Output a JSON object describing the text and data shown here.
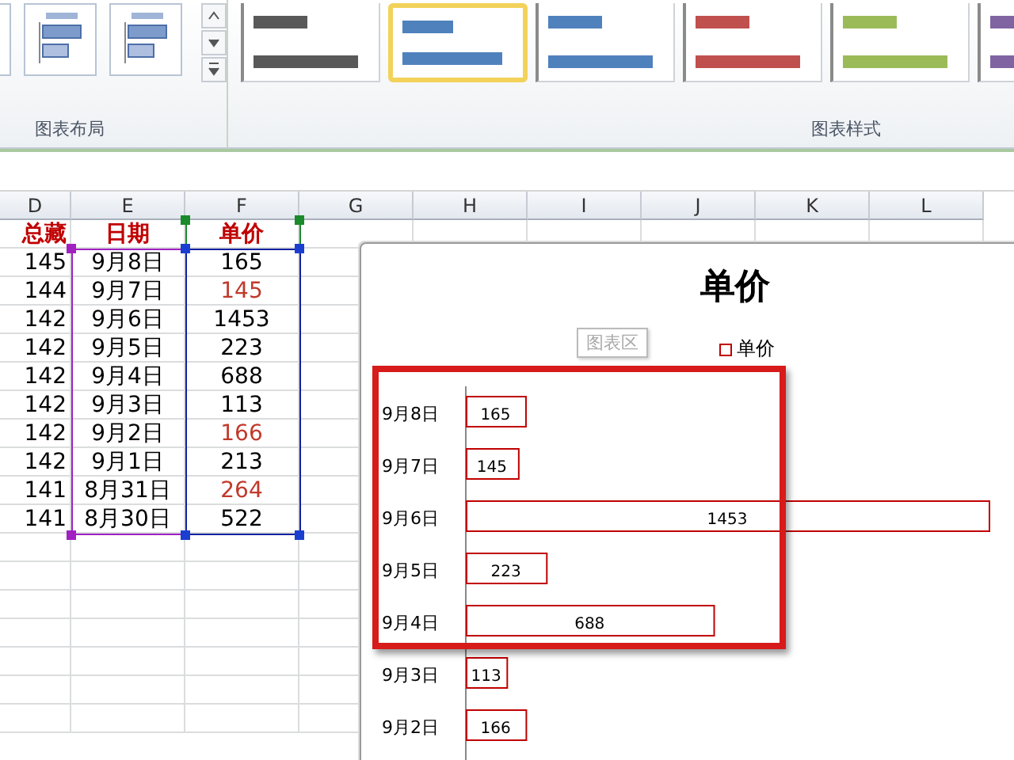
{
  "ribbon": {
    "layout_group": {
      "label": "图表布局",
      "layouts": [
        {
          "selected": false
        },
        {
          "selected": false
        },
        {
          "selected": false
        }
      ]
    },
    "style_group": {
      "label": "图表样式",
      "styles": [
        {
          "color": "#595959",
          "selected": false
        },
        {
          "color": "#4f81bd",
          "selected": true
        },
        {
          "color": "#4f81bd",
          "selected": false
        },
        {
          "color": "#c0504d",
          "selected": false
        },
        {
          "color": "#9bbb59",
          "selected": false
        },
        {
          "color": "#8064a2",
          "selected": false
        }
      ]
    }
  },
  "sheet": {
    "columns": [
      "D",
      "E",
      "F",
      "G",
      "H",
      "I",
      "J",
      "K",
      "L"
    ],
    "header": [
      "总藏",
      "日期",
      "单价"
    ],
    "rows": [
      {
        "total": "145",
        "date": "9月8日",
        "price": "165",
        "color": "#000000"
      },
      {
        "total": "144",
        "date": "9月7日",
        "price": "145",
        "color": "#c0392b"
      },
      {
        "total": "142",
        "date": "9月6日",
        "price": "1453",
        "color": "#000000"
      },
      {
        "total": "142",
        "date": "9月5日",
        "price": "223",
        "color": "#000000"
      },
      {
        "total": "142",
        "date": "9月4日",
        "price": "688",
        "color": "#000000"
      },
      {
        "total": "142",
        "date": "9月3日",
        "price": "113",
        "color": "#000000"
      },
      {
        "total": "142",
        "date": "9月2日",
        "price": "166",
        "color": "#c0392b"
      },
      {
        "total": "142",
        "date": "9月1日",
        "price": "213",
        "color": "#000000"
      },
      {
        "total": "141",
        "date": "8月31日",
        "price": "264",
        "color": "#c0392b"
      },
      {
        "total": "141",
        "date": "8月30日",
        "price": "522",
        "color": "#000000"
      }
    ]
  },
  "chart": {
    "title": "单价",
    "tooltip": "图表区",
    "chart_data": {
      "type": "bar",
      "orientation": "horizontal",
      "categories": [
        "9月8日",
        "9月7日",
        "9月6日",
        "9月5日",
        "9月4日",
        "9月3日",
        "9月2日"
      ],
      "series": [
        {
          "name": "单价",
          "color": "#c00000",
          "values": [
            165,
            145,
            1453,
            223,
            688,
            113,
            166
          ]
        }
      ],
      "data_labels": true
    }
  }
}
